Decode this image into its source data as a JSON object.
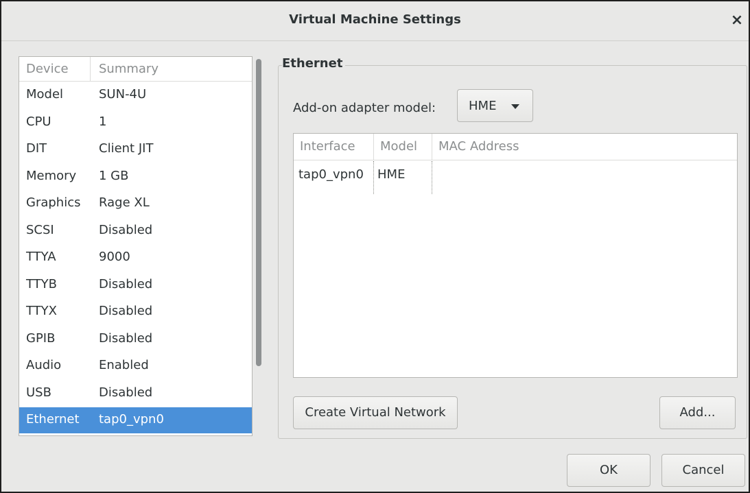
{
  "window": {
    "title": "Virtual Machine Settings",
    "close_glyph": "×"
  },
  "device_list": {
    "headers": [
      "Device",
      "Summary"
    ],
    "rows": [
      {
        "device": "Model",
        "summary": "SUN-4U"
      },
      {
        "device": "CPU",
        "summary": "1"
      },
      {
        "device": "DIT",
        "summary": "Client JIT"
      },
      {
        "device": "Memory",
        "summary": "1 GB"
      },
      {
        "device": "Graphics",
        "summary": "Rage XL"
      },
      {
        "device": "SCSI",
        "summary": "Disabled"
      },
      {
        "device": "TTYA",
        "summary": "9000"
      },
      {
        "device": "TTYB",
        "summary": "Disabled"
      },
      {
        "device": "TTYX",
        "summary": "Disabled"
      },
      {
        "device": "GPIB",
        "summary": "Disabled"
      },
      {
        "device": "Audio",
        "summary": "Enabled"
      },
      {
        "device": "USB",
        "summary": "Disabled"
      },
      {
        "device": "Ethernet",
        "summary": "tap0_vpn0"
      }
    ],
    "selected_index": 12
  },
  "ethernet": {
    "frame_label": "Ethernet",
    "adapter_label": "Add-on adapter model:",
    "adapter_value": "HME",
    "table": {
      "headers": [
        "Interface",
        "Model",
        "MAC Address"
      ],
      "rows": [
        {
          "interface": "tap0_vpn0",
          "model": "HME",
          "mac": ""
        }
      ]
    },
    "create_network_label": "Create Virtual Network",
    "add_label": "Add..."
  },
  "footer": {
    "ok_label": "OK",
    "cancel_label": "Cancel"
  },
  "colors": {
    "selection": "#4a90d9",
    "background": "#e8e8e7"
  }
}
